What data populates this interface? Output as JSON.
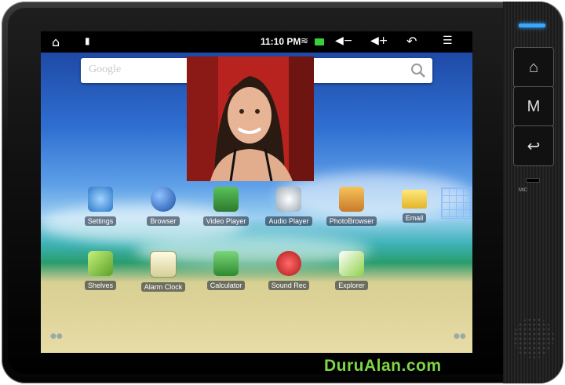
{
  "status_bar": {
    "time": "11:10 PM",
    "icons": [
      "home-icon",
      "sd-card-icon",
      "wifi-icon",
      "battery-icon",
      "volume-down-icon",
      "volume-up-icon",
      "back-icon",
      "menu-icon"
    ]
  },
  "search": {
    "placeholder": "Google"
  },
  "apps_row1": [
    {
      "label": "Settings",
      "icon": "settings-icon",
      "color": "#5aa9e6"
    },
    {
      "label": "Browser",
      "icon": "globe-icon",
      "color": "#2d6fd0"
    },
    {
      "label": "Video Player",
      "icon": "video-icon",
      "color": "#3fa64a"
    },
    {
      "label": "Audio Player",
      "icon": "audio-icon",
      "color": "#c7c7c7"
    },
    {
      "label": "PhotoBrowser",
      "icon": "photo-icon",
      "color": "#e9a33a"
    },
    {
      "label": "Email",
      "icon": "email-icon",
      "color": "#f2d24a"
    }
  ],
  "apps_row2": [
    {
      "label": "Shelves",
      "icon": "shelves-icon",
      "color": "#9bd34a"
    },
    {
      "label": "Alarm Clock",
      "icon": "clock-icon",
      "color": "#e8e3b5"
    },
    {
      "label": "Calculator",
      "icon": "calculator-icon",
      "color": "#4aa94a"
    },
    {
      "label": "Sound Rec",
      "icon": "microphone-icon",
      "color": "#d33"
    },
    {
      "label": "Explorer",
      "icon": "explorer-icon",
      "color": "#8fd24a"
    }
  ],
  "hardware": {
    "home_label": "⌂",
    "menu_label": "M",
    "back_label": "↩",
    "mic_label": "MIC"
  },
  "watermark": "DuruAlan.com"
}
